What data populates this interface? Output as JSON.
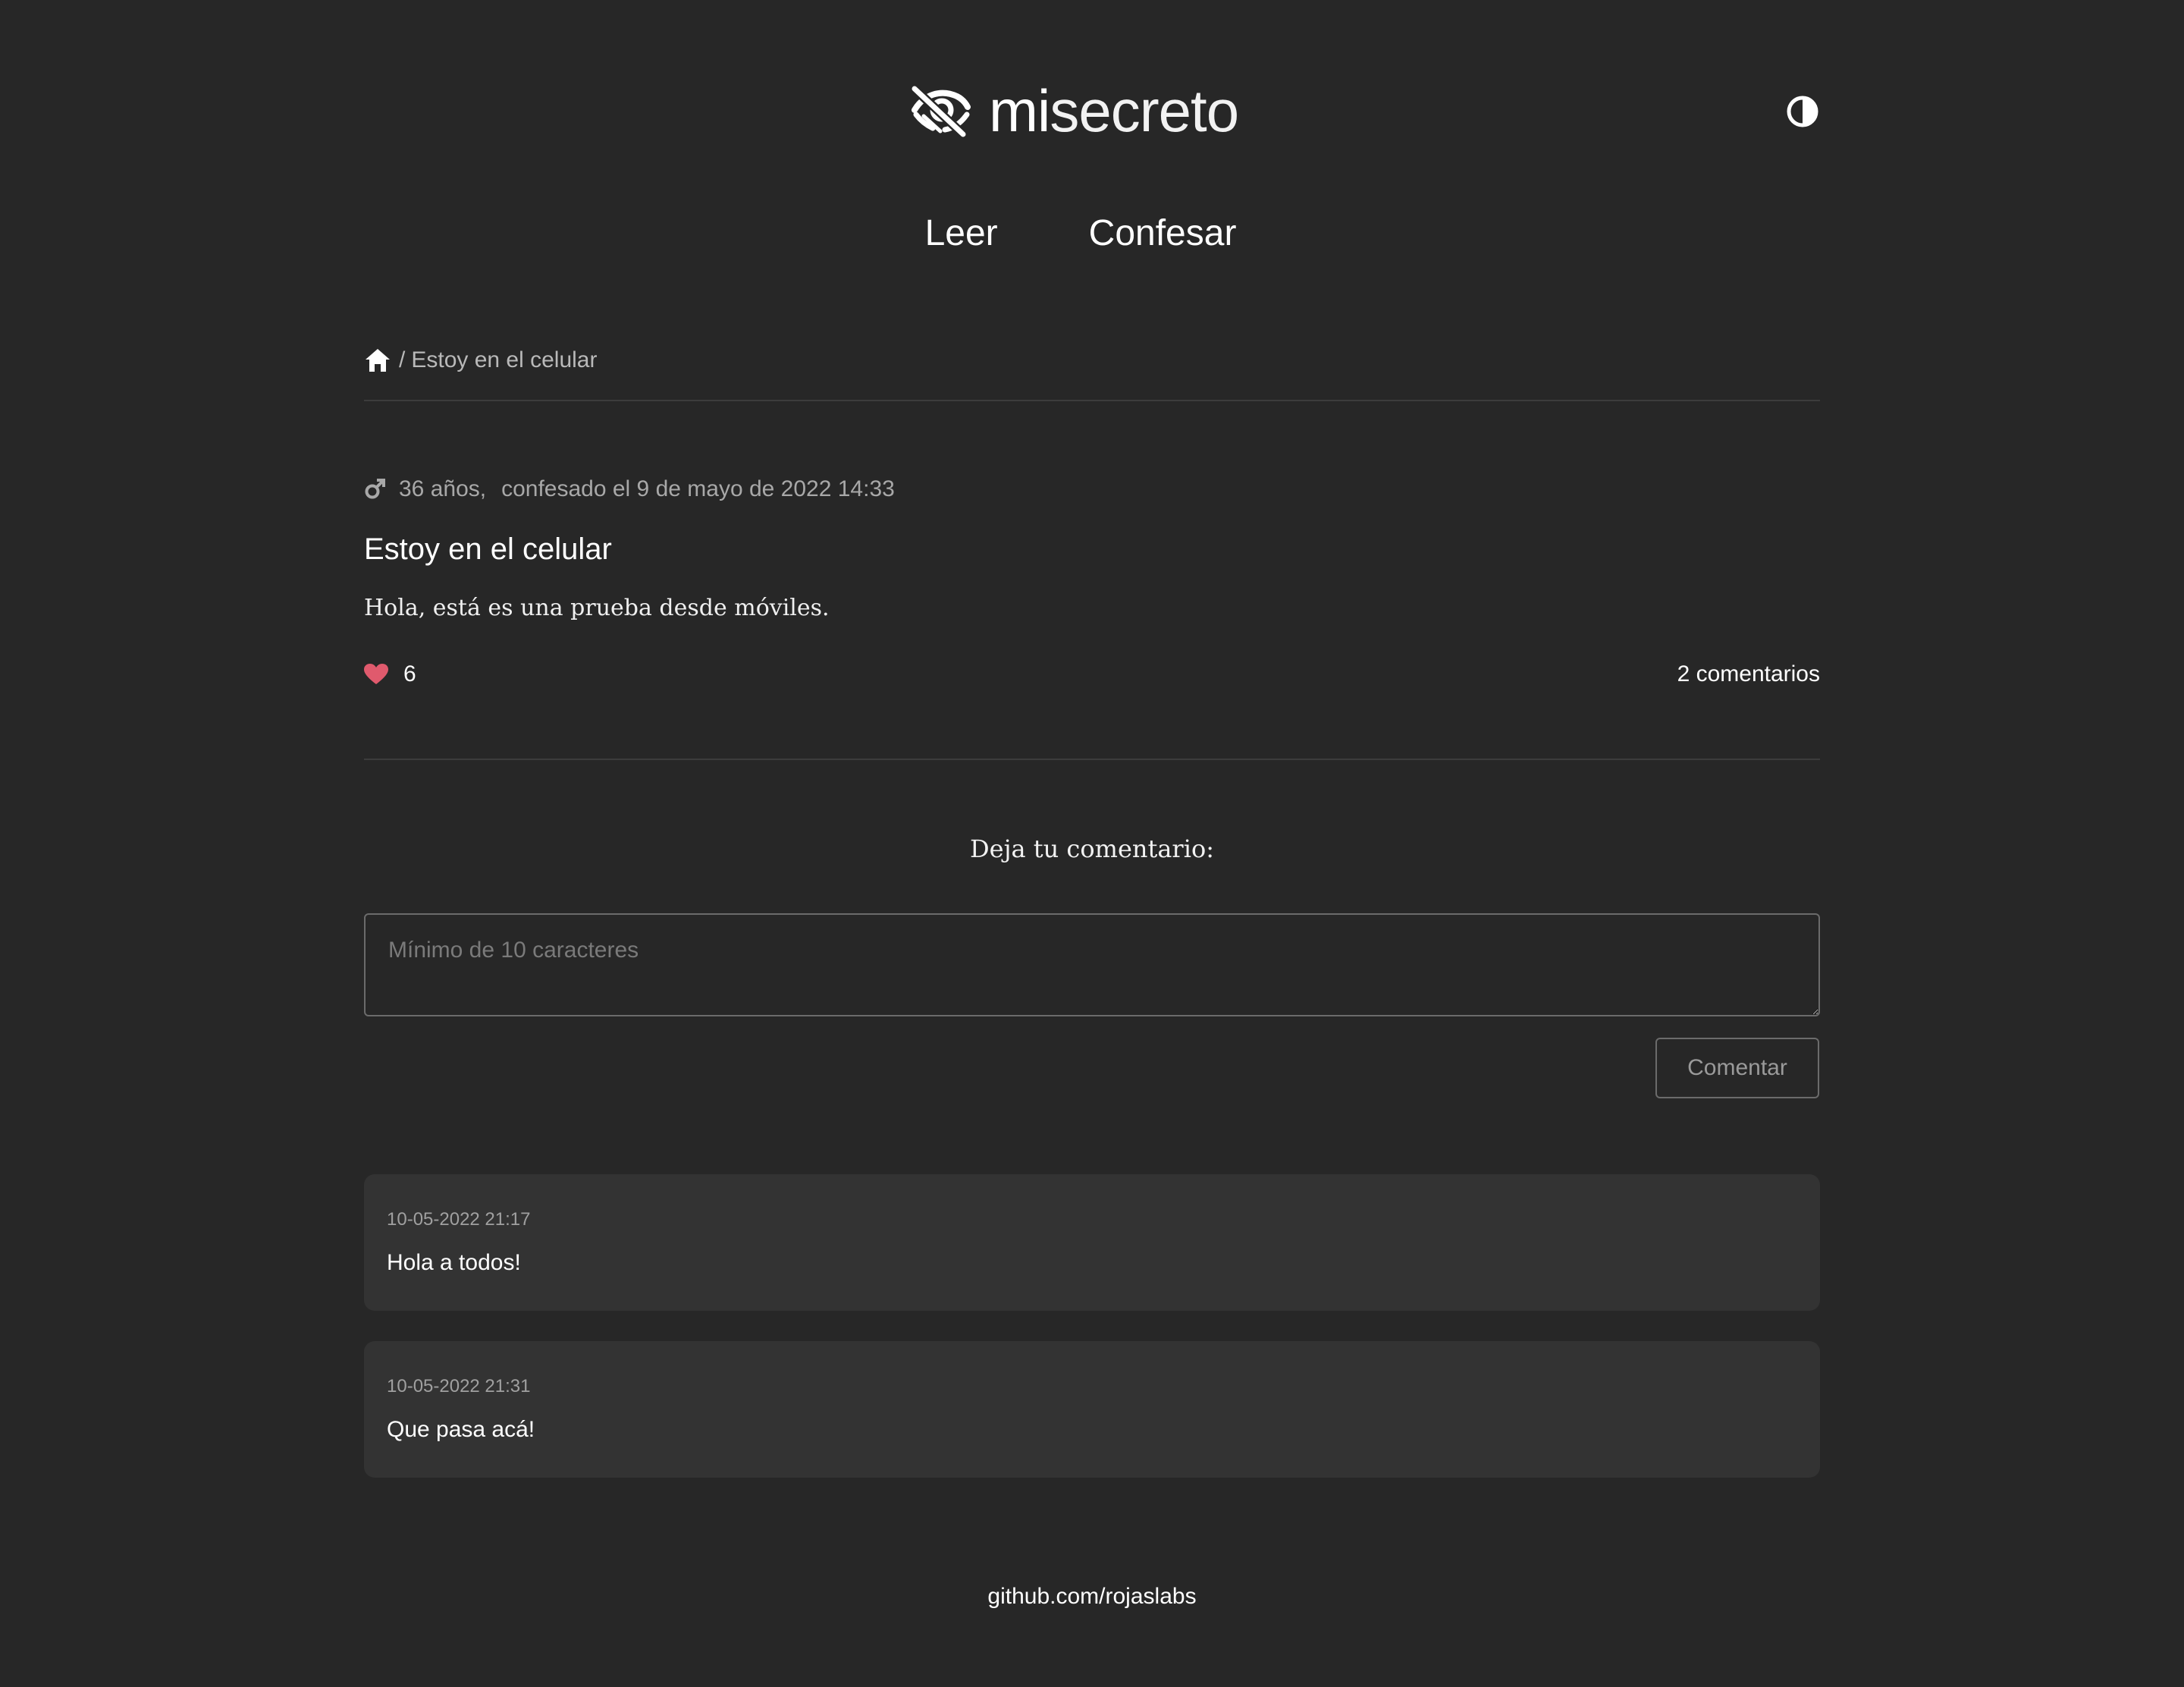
{
  "header": {
    "logo_icon": "eye-slash-icon",
    "logo_mi": "mi",
    "logo_secreto": "secreto",
    "theme_toggle_icon": "half-circle-contrast-icon"
  },
  "nav": {
    "items": [
      {
        "label": "Leer"
      },
      {
        "label": "Confesar"
      }
    ]
  },
  "breadcrumb": {
    "home_icon": "home-icon",
    "separator": "/",
    "current": "Estoy en el celular"
  },
  "post": {
    "gender_icon": "male-icon",
    "age": "36 años,",
    "date": "confesado el 9 de mayo de 2022 14:33",
    "title": "Estoy en el celular",
    "body": "Hola, está es una prueba desde móviles.",
    "like_icon": "heart-icon",
    "likes": "6",
    "comments_count": "2 comentarios",
    "heart_color": "#e05a6d"
  },
  "comment_form": {
    "title": "Deja tu comentario:",
    "placeholder": "Mínimo de 10 caracteres",
    "submit_label": "Comentar"
  },
  "comments": [
    {
      "date": "10-05-2022 21:17",
      "text": "Hola a todos!"
    },
    {
      "date": "10-05-2022 21:31",
      "text": "Que pasa acá!"
    }
  ],
  "footer": {
    "link": "github.com/rojaslabs"
  }
}
